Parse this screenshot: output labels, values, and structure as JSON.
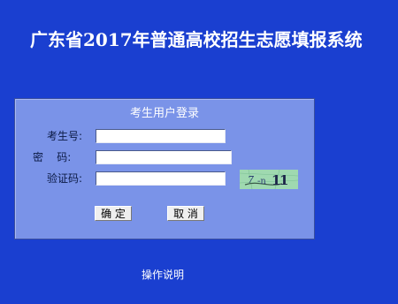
{
  "header": {
    "title": "广东省2017年普通高校招生志愿填报系统"
  },
  "login": {
    "panel_title": "考生用户登录",
    "candidate_no_label": "考生号:",
    "password_label": "密    码:",
    "verify_code_label": "验证码:",
    "candidate_no_value": "",
    "password_value": "",
    "verify_code_value": "",
    "captcha_text": "7-n 11",
    "ok_button": "确 定",
    "cancel_button": "取 消"
  },
  "footer": {
    "instructions_link": "操作说明"
  },
  "colors": {
    "page_background": "#1a3fd0",
    "panel_background": "#7a93e8",
    "captcha_background": "#9fd9b0"
  }
}
